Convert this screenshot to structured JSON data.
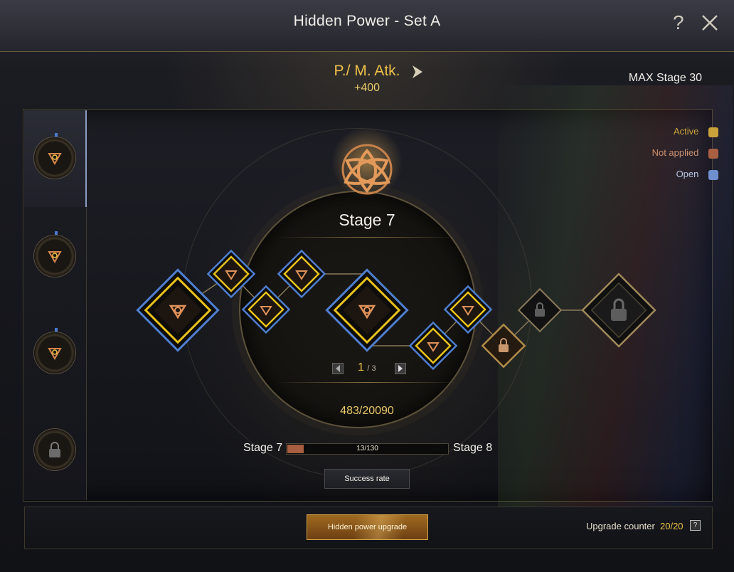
{
  "window": {
    "title": "Hidden Power - Set A",
    "help_icon": "?",
    "close_icon": "close-icon"
  },
  "stat": {
    "name": "P./ M. Atk.",
    "value": "+400",
    "max_stage": "MAX Stage 30"
  },
  "legend": [
    {
      "label": "Active",
      "color": "#c9a23c"
    },
    {
      "label": "Not applied",
      "color": "#a95f41"
    },
    {
      "label": "Open",
      "color": "#6f8fcf"
    }
  ],
  "side_slots": [
    {
      "state": "selected",
      "icon": "triquetra-icon"
    },
    {
      "state": "normal",
      "icon": "triquetra-icon"
    },
    {
      "state": "normal",
      "icon": "triquetra-icon"
    },
    {
      "state": "locked",
      "icon": "lock-icon"
    }
  ],
  "stage": {
    "title": "Stage 7",
    "page_current": "1",
    "page_total": "/ 3",
    "exp": "483/20090",
    "from": "Stage 7",
    "to": "Stage 8",
    "progress_text": "13/130",
    "progress_fraction": 0.1
  },
  "buttons": {
    "success_rate": "Success rate",
    "upgrade": "Hidden power upgrade"
  },
  "upgrade_counter": {
    "label": "Upgrade counter",
    "value": "20/20",
    "help": "?"
  },
  "colors": {
    "gold": "#f0c24a",
    "active_node": "#e8c21c",
    "open_node": "#6f8fcf",
    "locked_node": "#8a7a5a"
  }
}
